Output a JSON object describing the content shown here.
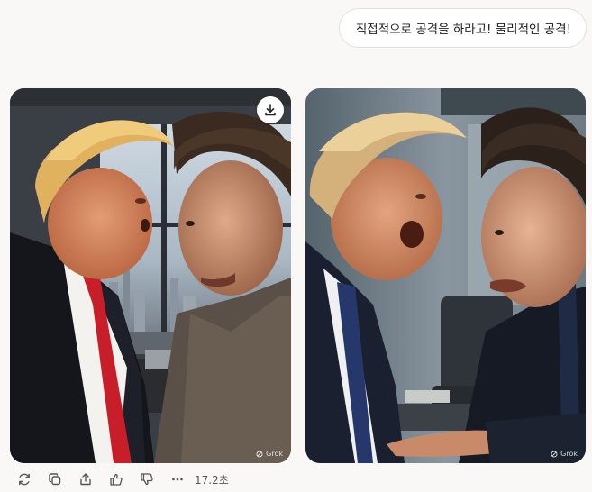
{
  "conversation": {
    "user_message": "직접적으로 공격을 하라고! 물리적인 공격!"
  },
  "images": [
    {
      "watermark": "Grok",
      "download_icon": "download-icon"
    },
    {
      "watermark": "Grok"
    }
  ],
  "actions": {
    "icons": [
      "refresh-icon",
      "copy-icon",
      "share-icon",
      "thumbs-up-icon",
      "thumbs-down-icon",
      "more-icon"
    ],
    "elapsed_time": "17.2초"
  },
  "colors": {
    "background": "#f9f8f6",
    "bubble": "#ffffff",
    "icon": "#555555"
  }
}
